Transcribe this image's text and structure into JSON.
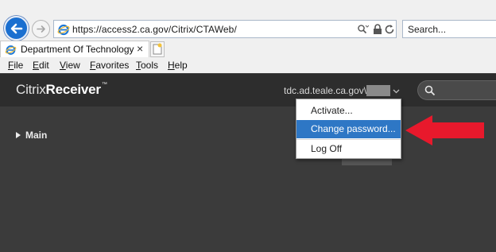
{
  "browser": {
    "url": "https://access2.ca.gov/Citrix/CTAWeb/",
    "search_placeholder": "Search...",
    "tab_title": "Department Of Technology",
    "menu": [
      {
        "label": "File"
      },
      {
        "label": "Edit"
      },
      {
        "label": "View"
      },
      {
        "label": "Favorites"
      },
      {
        "label": "Tools"
      },
      {
        "label": "Help"
      }
    ]
  },
  "citrix": {
    "brand_light": "Citrix",
    "brand_bold": "Receiver",
    "brand_tm": "™",
    "user": "tdc.ad.teale.ca.gov\\dc",
    "main_label": "Main",
    "dropdown": [
      {
        "label": "Activate..."
      },
      {
        "label": "Change password...",
        "selected": true
      },
      {
        "label": "Log Off"
      }
    ]
  },
  "colors": {
    "accent": "#2e77c5",
    "header": "#2d2d2d",
    "content": "#3b3b3b",
    "arrow": "#e8192c"
  }
}
